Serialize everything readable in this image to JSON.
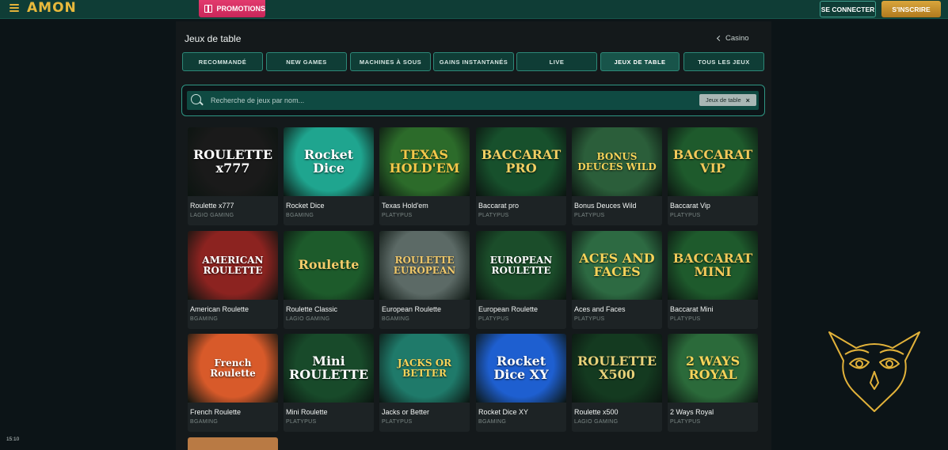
{
  "brand": {
    "logo_text": "AMON"
  },
  "header": {
    "promotions_label": "PROMOTIONS",
    "login_label": "SE CONNECTER",
    "signup_label": "S'INSCRIRE"
  },
  "page": {
    "title": "Jeux de table",
    "back_label": "Casino"
  },
  "tabs": [
    {
      "label": "RECOMMANDÉ",
      "active": false
    },
    {
      "label": "NEW GAMES",
      "active": false
    },
    {
      "label": "MACHINES À SOUS",
      "active": false
    },
    {
      "label": "GAINS INSTANTANÉS",
      "active": false
    },
    {
      "label": "LIVE",
      "active": false
    },
    {
      "label": "JEUX DE TABLE",
      "active": true
    },
    {
      "label": "TOUS LES JEUX",
      "active": false
    }
  ],
  "search": {
    "placeholder": "Recherche de jeux par nom...",
    "filter_chip": "Jeux de table",
    "chip_close": "×"
  },
  "games": [
    {
      "name": "Roulette x777",
      "provider": "LAGIO GAMING",
      "art": "ROULETTE x777",
      "bg": "#1a1a1a",
      "fg": "#ffffff"
    },
    {
      "name": "Rocket Dice",
      "provider": "BGAMING",
      "art": "Rocket Dice",
      "bg": "#1fa58f",
      "fg": "#ffffff"
    },
    {
      "name": "Texas Hold'em",
      "provider": "PLATYPUS",
      "art": "TEXAS HOLD'EM",
      "bg": "#2c6b2a",
      "fg": "#f3c84a"
    },
    {
      "name": "Baccarat pro",
      "provider": "PLATYPUS",
      "art": "BACCARAT PRO",
      "bg": "#17502c",
      "fg": "#f1cf63"
    },
    {
      "name": "Bonus Deuces Wild",
      "provider": "PLATYPUS",
      "art": "BONUS DEUCES WILD",
      "bg": "#2b5e3a",
      "fg": "#f6d35a"
    },
    {
      "name": "Baccarat Vip",
      "provider": "PLATYPUS",
      "art": "BACCARAT VIP",
      "bg": "#1e5a2c",
      "fg": "#f1c95a"
    },
    {
      "name": "American Roulette",
      "provider": "BGAMING",
      "art": "AMERICAN ROULETTE",
      "bg": "#8c2320",
      "fg": "#ffffff"
    },
    {
      "name": "Roulette Classic",
      "provider": "LAGIO GAMING",
      "art": "Roulette",
      "bg": "#1d5b2b",
      "fg": "#f2cc6a"
    },
    {
      "name": "European Roulette",
      "provider": "BGAMING",
      "art": "ROULETTE EUROPEAN",
      "bg": "#5c6a66",
      "fg": "#f0c86a"
    },
    {
      "name": "European Roulette",
      "provider": "PLATYPUS",
      "art": "EUROPEAN ROULETTE",
      "bg": "#1b4d2a",
      "fg": "#ffffff"
    },
    {
      "name": "Aces and Faces",
      "provider": "PLATYPUS",
      "art": "ACES AND FACES",
      "bg": "#2d6a42",
      "fg": "#f6d35a"
    },
    {
      "name": "Baccarat Mini",
      "provider": "PLATYPUS",
      "art": "BACCARAT MINI",
      "bg": "#1e5a2c",
      "fg": "#f1c95a"
    },
    {
      "name": "French Roulette",
      "provider": "BGAMING",
      "art": "French Roulette",
      "bg": "#d85a2a",
      "fg": "#ffffff"
    },
    {
      "name": "Mini Roulette",
      "provider": "PLATYPUS",
      "art": "Mini ROULETTE",
      "bg": "#184a2a",
      "fg": "#ffffff"
    },
    {
      "name": "Jacks or Better",
      "provider": "PLATYPUS",
      "art": "JACKS OR BETTER",
      "bg": "#1f7a6a",
      "fg": "#f6d35a"
    },
    {
      "name": "Rocket Dice XY",
      "provider": "BGAMING",
      "art": "Rocket Dice XY",
      "bg": "#1e5fd0",
      "fg": "#ffffff"
    },
    {
      "name": "Roulette x500",
      "provider": "LAGIO GAMING",
      "art": "ROULETTE X500",
      "bg": "#143a20",
      "fg": "#e8d27a"
    },
    {
      "name": "2 Ways Royal",
      "provider": "PLATYPUS",
      "art": "2 WAYS ROYAL",
      "bg": "#2b6a3a",
      "fg": "#f6d35a"
    }
  ],
  "status": {
    "clock": "15:10"
  },
  "colors": {
    "accent_teal": "#0f3d36",
    "brand_gold": "#e8b93c",
    "promo_pink": "#e23a6d"
  }
}
